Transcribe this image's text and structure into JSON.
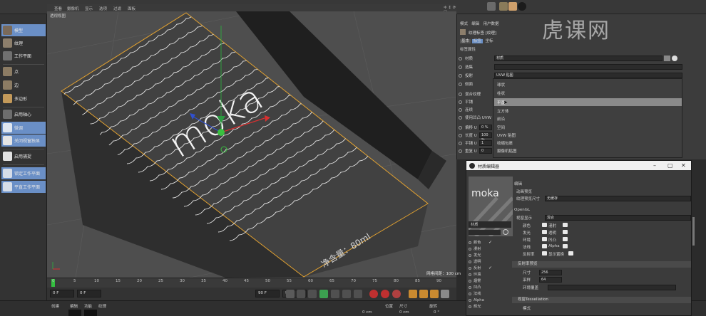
{
  "top_menu": [
    "查看",
    "摄像机",
    "显示",
    "选项",
    "过滤",
    "面板"
  ],
  "viewport": {
    "title": "透视视图",
    "grid_spacing": "网格间距：100 cm",
    "product": {
      "logo": "moka",
      "volume_text": "净含量：80ml"
    }
  },
  "left_toolbar": [
    {
      "label": "模型",
      "hi": true
    },
    {
      "label": "纹理",
      "hi": false
    },
    {
      "label": "工作平面",
      "hi": false
    },
    {
      "label": "点",
      "hi": false
    },
    {
      "label": "边",
      "hi": false
    },
    {
      "label": "多边形",
      "hi": false
    },
    {
      "label": "启用轴心",
      "hi": false
    },
    {
      "label": "微调",
      "hi": true
    },
    {
      "label": "关闭视窗独显",
      "hi": true
    },
    {
      "label": "启用捕捉",
      "hi": false
    },
    {
      "label": "锁定工作平面",
      "hi": true
    },
    {
      "label": "平直工作平面",
      "hi": true
    }
  ],
  "timeline": {
    "ticks": [
      "0",
      "5",
      "10",
      "15",
      "20",
      "25",
      "30",
      "35",
      "40",
      "45",
      "50",
      "55",
      "60",
      "65",
      "70",
      "75",
      "80",
      "85",
      "90"
    ],
    "start_field": "0 F",
    "current_field": "0 F",
    "end_field": "90 F",
    "end_field2": "90 F"
  },
  "bottom_menu": [
    "创建",
    "编辑",
    "功能",
    "纹理"
  ],
  "bottom_fields": [
    "位置",
    "尺寸",
    "旋转",
    "0 cm",
    "0 cm",
    "0 °"
  ],
  "attributes": {
    "tabs": [
      "模式",
      "编辑",
      "用户数据"
    ],
    "header": "纹理标签 [纹理]",
    "subtabs": [
      "基本",
      "标签",
      "坐标"
    ],
    "section": "标签属性",
    "rows": [
      {
        "label": "材质",
        "value": "材质"
      },
      {
        "label": "选集",
        "value": ""
      },
      {
        "label": "投射",
        "value": "UVW 贴图"
      },
      {
        "label": "侧面",
        "value": ""
      },
      {
        "label": "混合纹理",
        "value": ""
      },
      {
        "label": "平铺",
        "value": ""
      },
      {
        "label": "连续",
        "value": ""
      },
      {
        "label": "使用凹凸 UVW",
        "value": ""
      },
      {
        "label": "偏移 U",
        "value": "0 %"
      },
      {
        "label": "长度 U",
        "value": "100 %"
      },
      {
        "label": "平铺 U",
        "value": "1"
      },
      {
        "label": "重复 U",
        "value": "0"
      }
    ],
    "dropdown": [
      "球状",
      "柱状",
      "平直",
      "立方体",
      "前沿",
      "空间",
      "UVW 贴图",
      "收缩包裹",
      "摄像机贴图"
    ],
    "dropdown_selected": "平直"
  },
  "material_editor": {
    "title": "材质编辑器",
    "preview_logo": "moka",
    "material_name": "材质",
    "channels": [
      {
        "label": "颜色",
        "on": true
      },
      {
        "label": "漫射",
        "on": false
      },
      {
        "label": "发光",
        "on": false
      },
      {
        "label": "透明",
        "on": false
      },
      {
        "label": "反射",
        "on": true
      },
      {
        "label": "环境",
        "on": false
      },
      {
        "label": "烟雾",
        "on": false
      },
      {
        "label": "凹凸",
        "on": false
      },
      {
        "label": "法线",
        "on": false
      },
      {
        "label": "Alpha",
        "on": false
      },
      {
        "label": "辉光",
        "on": false
      }
    ],
    "right": {
      "section": "编辑",
      "anim_preview_label": "动画预览",
      "anim_preview_value": "",
      "tex_preview_size_label": "纹理预览尺寸",
      "tex_preview_size_value": "无缓存",
      "opengl": "OpenGL",
      "reflection_label": "视窗显示",
      "reflection_value": "混合",
      "grid": [
        [
          "颜色",
          "漫射"
        ],
        [
          "发光",
          "透明"
        ],
        [
          "环境",
          "凹凸"
        ],
        [
          "法线",
          "Alpha"
        ],
        [
          "反射率",
          "显示置换"
        ]
      ],
      "preview_section": "反射率预览",
      "size_label": "尺寸",
      "size_value": "256",
      "sample_label": "采样",
      "sample_value": "64",
      "env_label": "环境覆盖",
      "tess_section": "视窗Tessellation",
      "mode_label": "模式"
    }
  },
  "watermark": "虎课网"
}
